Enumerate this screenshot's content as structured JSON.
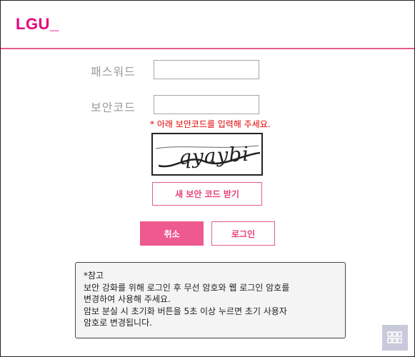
{
  "header": {
    "logo": "LGU_"
  },
  "form": {
    "password_label": "패스워드",
    "password_value": "",
    "security_label": "보안코드",
    "security_value": "",
    "notice": "* 아래 보안코드를 입력해 주세요.",
    "captcha_text": "qyaybi",
    "new_code_button": "새 보안 코드 받기",
    "cancel_button": "취소",
    "login_button": "로그인"
  },
  "note": {
    "title": "*참고",
    "lines": [
      "보안 강화를 위해 로그인 후 무선 암호와 웹 로그인 암호를",
      "변경하여 사용해 주세요.",
      "암보 분실 시 초기화 버튼을 5초 이상 누르면 초기 사용자",
      "암호로 변경됩니다."
    ]
  },
  "colors": {
    "accent": "#e6007e",
    "button_fill": "#ee5a8f",
    "notice": "#e00000"
  },
  "icons": {
    "corner": "grid-squares-icon"
  }
}
